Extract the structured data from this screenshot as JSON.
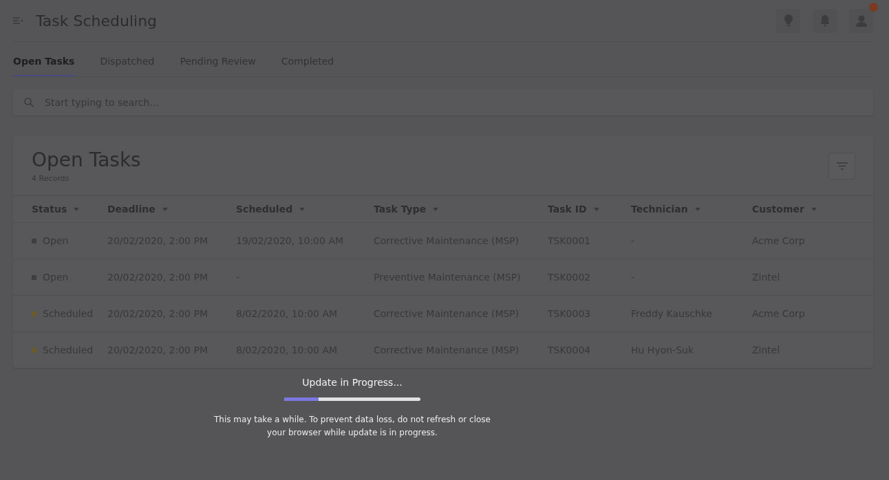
{
  "header": {
    "title": "Task Scheduling",
    "notification_badge": true
  },
  "tabs": [
    {
      "label": "Open Tasks",
      "selected": true
    },
    {
      "label": "Dispatched",
      "selected": false
    },
    {
      "label": "Pending Review",
      "selected": false
    },
    {
      "label": "Completed",
      "selected": false
    }
  ],
  "search": {
    "placeholder": "Start typing to search..."
  },
  "card": {
    "title": "Open Tasks",
    "subtitle": "4 Records"
  },
  "table": {
    "columns": [
      "Status",
      "Deadline",
      "Scheduled",
      "Task Type",
      "Task ID",
      "Technician",
      "Customer"
    ],
    "rows": [
      {
        "color": "#3e3e40",
        "cells": [
          "Open",
          "20/02/2020, 2:00 PM",
          "19/02/2020, 10:00 AM",
          "Corrective Maintenance (MSP)",
          "TSK0001",
          "-",
          "Acme Corp"
        ]
      },
      {
        "color": "#3e3e40",
        "cells": [
          "Open",
          "20/02/2020, 2:00 PM",
          "-",
          "Preventive Maintenance (MSP)",
          "TSK0002",
          "-",
          "Zintel"
        ]
      },
      {
        "color": "#6b5a2a",
        "cells": [
          "Scheduled",
          "20/02/2020, 2:00 PM",
          "8/02/2020, 10:00 AM",
          "Corrective Maintenance (MSP)",
          "TSK0003",
          "Freddy Kauschke",
          "Acme Corp"
        ]
      },
      {
        "color": "#6b5a2a",
        "cells": [
          "Scheduled",
          "20/02/2020, 2:00 PM",
          "8/02/2020, 10:00 AM",
          "Corrective Maintenance (MSP)",
          "TSK0004",
          "Hu Hyon-Suk",
          "Zintel"
        ]
      }
    ]
  },
  "progress_dialog": {
    "title": "Update in Progress...",
    "level": 0.25,
    "message": "This may take a while. To prevent data loss, do not refresh or close your browser while update is in progress."
  }
}
